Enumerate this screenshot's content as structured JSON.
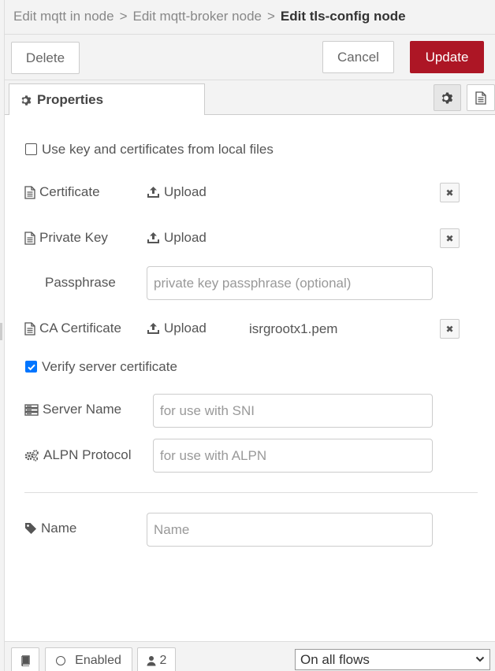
{
  "breadcrumb": {
    "items": [
      "Edit mqtt in node",
      "Edit mqtt-broker node"
    ],
    "separator": ">",
    "current": "Edit tls-config node"
  },
  "toolbar": {
    "delete_label": "Delete",
    "cancel_label": "Cancel",
    "update_label": "Update"
  },
  "tabs": {
    "properties_label": "Properties"
  },
  "form": {
    "use_local_files_label": "Use key and certificates from local files",
    "use_local_files_checked": false,
    "certificate_label": "Certificate",
    "certificate_upload": "Upload",
    "private_key_label": "Private Key",
    "private_key_upload": "Upload",
    "passphrase_label": "Passphrase",
    "passphrase_placeholder": "private key passphrase (optional)",
    "ca_cert_label": "CA Certificate",
    "ca_cert_upload": "Upload",
    "ca_cert_filename": "isrgrootx1.pem",
    "verify_label": "Verify server certificate",
    "verify_checked": true,
    "server_name_label": "Server Name",
    "server_name_placeholder": "for use with SNI",
    "alpn_label": "ALPN Protocol",
    "alpn_placeholder": "for use with ALPN",
    "name_label": "Name",
    "name_placeholder": "Name"
  },
  "footer": {
    "enabled_label": "Enabled",
    "users_count": "2",
    "scope_selected": "On all flows"
  },
  "colors": {
    "update_button": "#ad1625",
    "checkbox_checked": "#0075ff"
  }
}
